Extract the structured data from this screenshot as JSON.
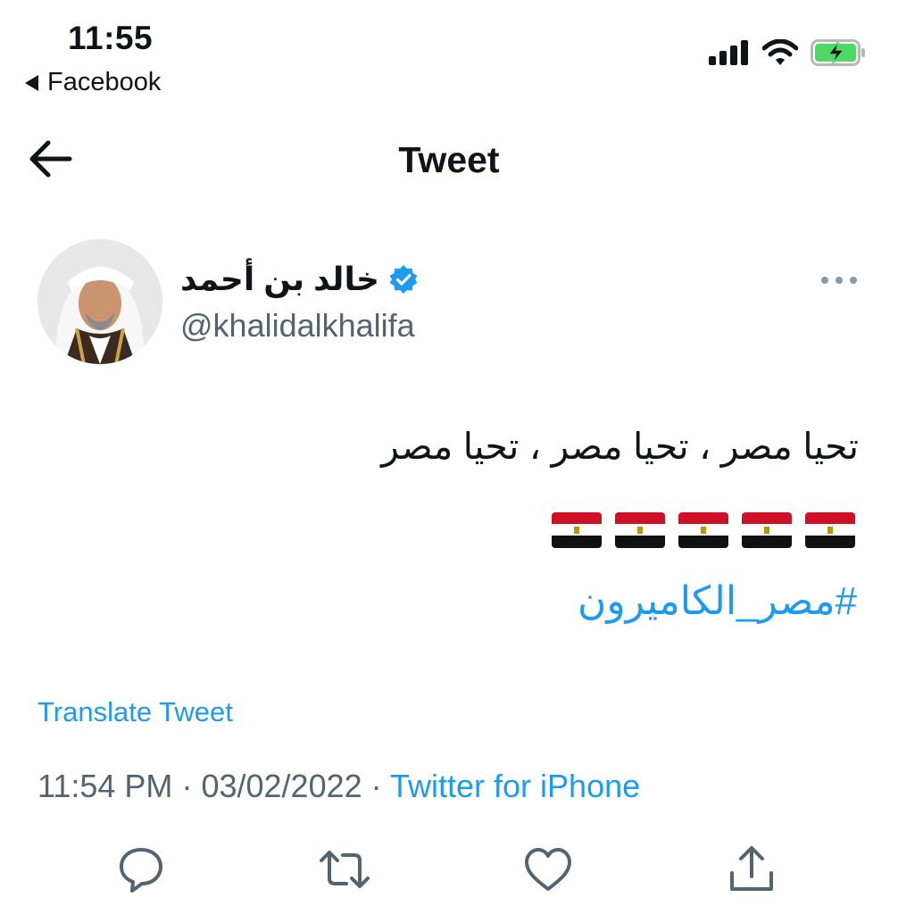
{
  "status_bar": {
    "time": "11:55",
    "back_app": "Facebook",
    "icons": [
      "signal-icon",
      "wifi-icon",
      "battery-charging-icon"
    ]
  },
  "nav": {
    "title": "Tweet",
    "back_icon": "arrow-left-icon"
  },
  "tweet": {
    "author_name": "خالد بن أحمد",
    "verified_icon": "verified-badge-icon",
    "handle": "@khalidalkhalifa",
    "text": "تحيا مصر ، تحيا مصر ، تحيا مصر",
    "flags": [
      "egypt-flag",
      "egypt-flag",
      "egypt-flag",
      "egypt-flag",
      "egypt-flag"
    ],
    "hashtag": "#مصر_الكاميرون",
    "translate_label": "Translate Tweet",
    "time": "11:54 PM",
    "date": "03/02/2022",
    "separator": "·",
    "source": "Twitter for iPhone"
  },
  "actions": [
    "reply-icon",
    "retweet-icon",
    "like-icon",
    "share-icon"
  ],
  "colors": {
    "accent": "#1d9bf0",
    "secondary_text": "#536471",
    "primary_text": "#0f1419",
    "battery": "#4cd964"
  }
}
